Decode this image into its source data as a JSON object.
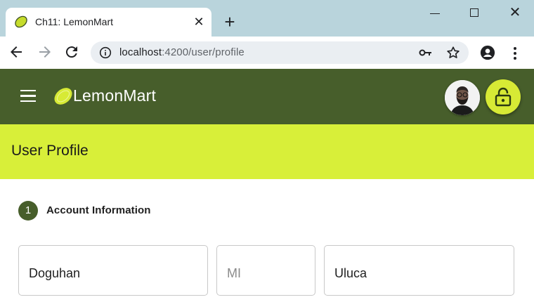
{
  "browser": {
    "tab_title": "Ch11: LemonMart",
    "url_host": "localhost",
    "url_path": ":4200/user/profile"
  },
  "app": {
    "title": "LemonMart",
    "header_color": "#475e2b",
    "accent_color": "#d8ef39"
  },
  "page": {
    "title": "User Profile"
  },
  "stepper": {
    "step_number": "1",
    "step_label": "Account Information"
  },
  "form": {
    "first_name": {
      "value": "Doguhan",
      "placeholder": ""
    },
    "middle_initial": {
      "value": "",
      "placeholder": "MI"
    },
    "last_name": {
      "value": "Uluca",
      "placeholder": ""
    }
  }
}
